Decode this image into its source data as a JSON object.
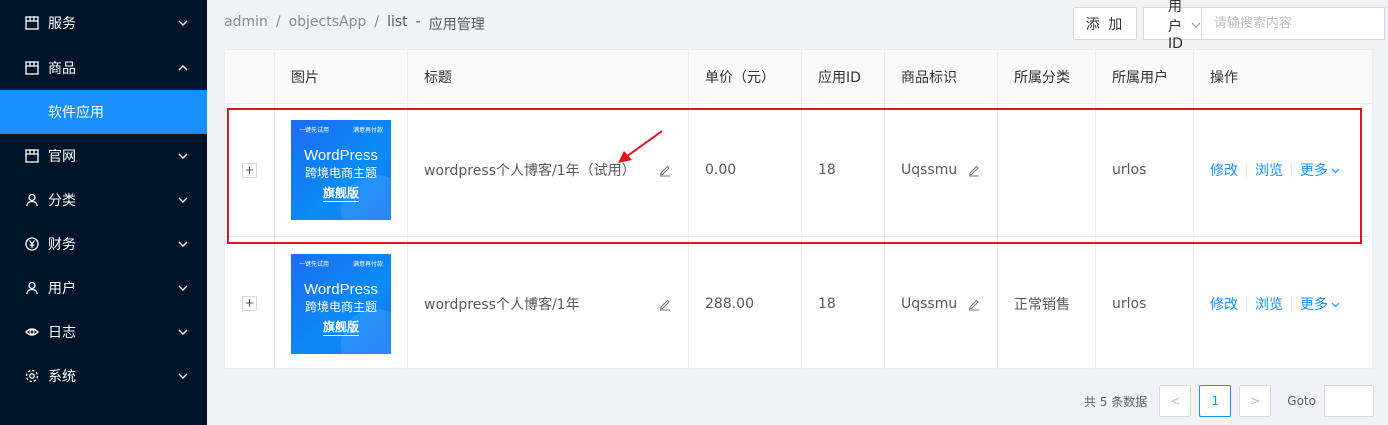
{
  "sidebar": {
    "items": [
      {
        "label": "服务",
        "icon": "shop-icon",
        "expanded": false
      },
      {
        "label": "商品",
        "icon": "shop-icon",
        "expanded": true
      },
      {
        "label": "软件应用",
        "sub": true,
        "active": true
      },
      {
        "label": "官网",
        "icon": "shop-icon",
        "expanded": false
      },
      {
        "label": "分类",
        "icon": "user-icon",
        "expanded": false
      },
      {
        "label": "财务",
        "icon": "yen-icon",
        "expanded": false
      },
      {
        "label": "用户",
        "icon": "user-icon",
        "expanded": false
      },
      {
        "label": "日志",
        "icon": "eye-icon",
        "expanded": false
      },
      {
        "label": "系统",
        "icon": "gear-icon",
        "expanded": false
      }
    ],
    "bg_color": "#001529",
    "active_color": "#1890ff"
  },
  "breadcrumb": {
    "items": [
      "admin",
      "/",
      "objectsApp",
      "/",
      "list",
      "-",
      "应用管理"
    ]
  },
  "toolbar": {
    "add_label": "添 加",
    "search_field": "用户ID",
    "search_placeholder": "请输搜索内容"
  },
  "table": {
    "headers": [
      "",
      "图片",
      "标题",
      "单价（元）",
      "应用ID",
      "商品标识",
      "所属分类",
      "所属用户",
      "操作"
    ],
    "rows": [
      {
        "expand": "+",
        "thumb": {
          "tl": "一键先试用",
          "tr": "满意再付款",
          "wp": "WordPress",
          "zh": "跨境电商主题",
          "flag": "旗舰版"
        },
        "title": "wordpress个人博客/1年（试用）",
        "price": "0.00",
        "app_id": "18",
        "sku": "Uqssmu",
        "category": "",
        "owner": "urlos",
        "ops": [
          "修改",
          "浏览",
          "更多"
        ]
      },
      {
        "expand": "+",
        "thumb": {
          "tl": "一键先试用",
          "tr": "满意再付款",
          "wp": "WordPress",
          "zh": "跨境电商主题",
          "flag": "旗舰版"
        },
        "title": "wordpress个人博客/1年",
        "price": "288.00",
        "app_id": "18",
        "sku": "Uqssmu",
        "category": "正常销售",
        "owner": "urlos",
        "ops": [
          "修改",
          "浏览",
          "更多"
        ]
      }
    ]
  },
  "pagination": {
    "total_text": "共 5 条数据",
    "prev": "<",
    "current": "1",
    "next": ">",
    "goto_label": "Goto"
  },
  "colors": {
    "link": "#1890ff",
    "highlight": "#e0141e"
  }
}
